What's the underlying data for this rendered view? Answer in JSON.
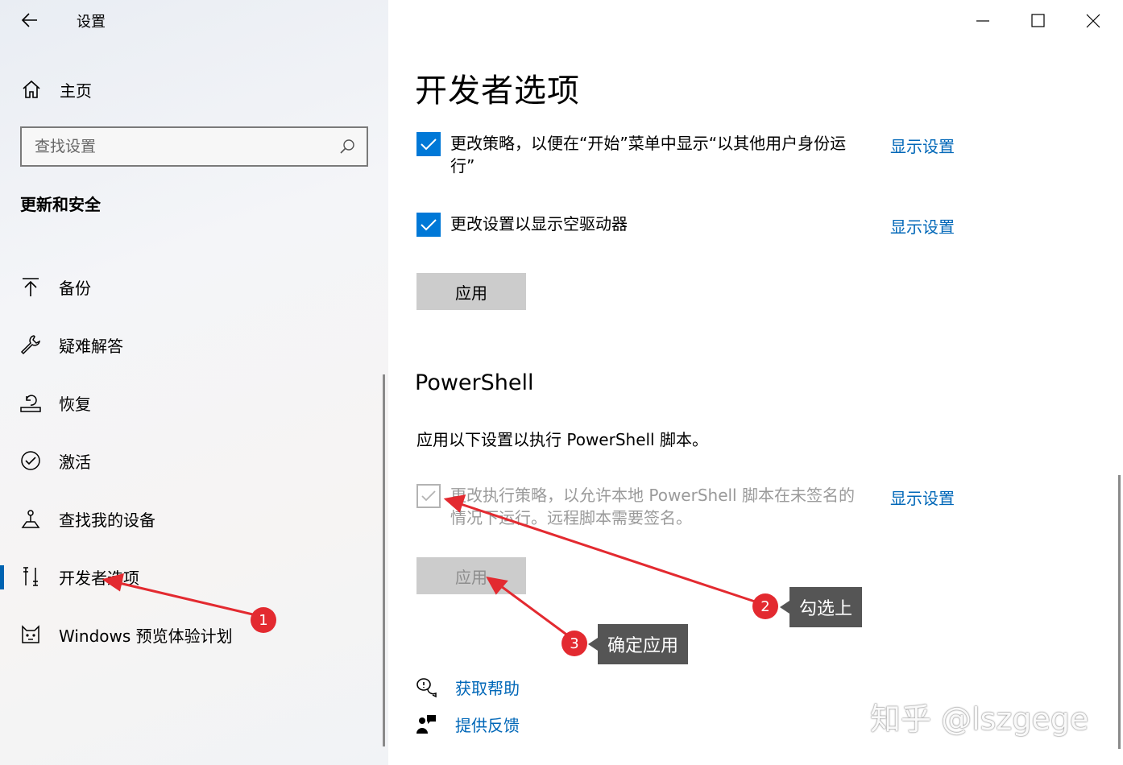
{
  "window": {
    "title": "设置"
  },
  "sidebar": {
    "home_label": "主页",
    "search_placeholder": "查找设置",
    "section_title": "更新和安全",
    "items": [
      {
        "label": "备份",
        "icon": "backup-arrow-icon"
      },
      {
        "label": "疑难解答",
        "icon": "wrench-icon"
      },
      {
        "label": "恢复",
        "icon": "recovery-icon"
      },
      {
        "label": "激活",
        "icon": "check-circle-icon"
      },
      {
        "label": "查找我的设备",
        "icon": "find-device-icon"
      },
      {
        "label": "开发者选项",
        "icon": "developer-tools-icon",
        "active": true
      },
      {
        "label": "Windows 预览体验计划",
        "icon": "insider-cat-icon"
      }
    ]
  },
  "main": {
    "title": "开发者选项",
    "options": [
      {
        "text_line1": "更改策略，以便在“开始”菜单中显示“以其他用户身份运",
        "text_line2": "行”",
        "checked": true,
        "link": "显示设置"
      },
      {
        "text_line1": "更改设置以显示空驱动器",
        "checked": true,
        "link": "显示设置"
      }
    ],
    "apply_label": "应用",
    "powershell": {
      "title": "PowerShell",
      "description": "应用以下设置以执行 PowerShell 脚本。",
      "option_line1": "更改执行策略，以允许本地 PowerShell 脚本在未签名的",
      "option_line2": "情况下运行。远程脚本需要签名。",
      "option_checked": false,
      "link": "显示设置",
      "apply_label": "应用"
    },
    "help": {
      "get_help": "获取帮助",
      "feedback": "提供反馈"
    }
  },
  "annotations": {
    "badge1": "1",
    "badge2": "2",
    "badge3": "3",
    "callout2": "勾选上",
    "callout3": "确定应用",
    "color": "#e32a30"
  },
  "watermark": "知乎 @lszgege",
  "colors": {
    "accent": "#0078d7",
    "link": "#0067b8",
    "annotation_red": "#e32a30"
  }
}
